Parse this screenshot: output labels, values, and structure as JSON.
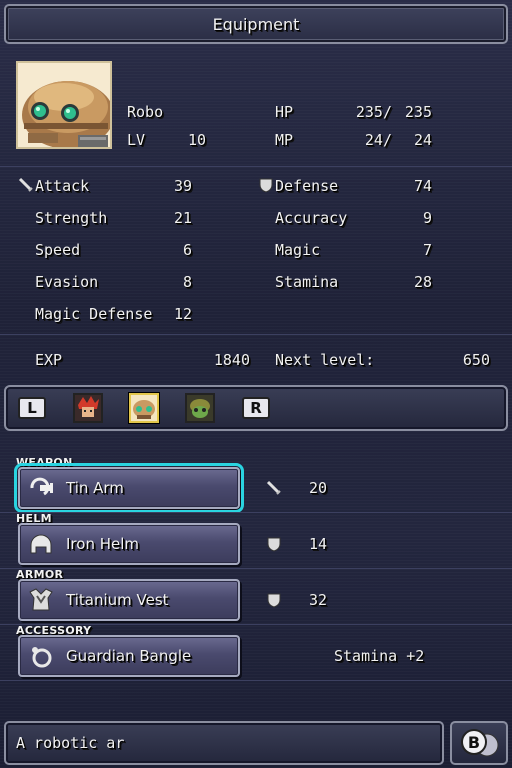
{
  "title": "Equipment",
  "character": {
    "name": "Robo",
    "lv_label": "LV",
    "lv": "10",
    "hp_label": "HP",
    "hp_current": "235/",
    "hp_max": "235",
    "mp_label": "MP",
    "mp_current": "24/",
    "mp_max": "24"
  },
  "stats": {
    "attack_label": "Attack",
    "attack": "39",
    "defense_label": "Defense",
    "defense": "74",
    "strength_label": "Strength",
    "strength": "21",
    "accuracy_label": "Accuracy",
    "accuracy": "9",
    "speed_label": "Speed",
    "speed": "6",
    "magic_label": "Magic",
    "magic": "7",
    "evasion_label": "Evasion",
    "evasion": "8",
    "stamina_label": "Stamina",
    "stamina": "28",
    "magic_defense_label": "Magic Defense",
    "magic_defense": "12",
    "exp_label": "EXP",
    "exp": "1840",
    "next_level_label": "Next level:",
    "next_level": "650"
  },
  "party_strip": {
    "left_button": "L",
    "right_button": "R"
  },
  "slots": [
    {
      "label": "WEAPON",
      "item": "Tin Arm",
      "value": "20",
      "icon": "arm-cannon-icon",
      "value_icon": "sword-icon"
    },
    {
      "label": "HELM",
      "item": "Iron Helm",
      "value": "14",
      "icon": "helm-icon",
      "value_icon": "shield-icon"
    },
    {
      "label": "ARMOR",
      "item": "Titanium Vest",
      "value": "32",
      "icon": "vest-icon",
      "value_icon": "shield-icon"
    },
    {
      "label": "ACCESSORY",
      "item": "Guardian Bangle",
      "value": "Stamina +2",
      "icon": "bangle-icon"
    }
  ],
  "message": "A robotic ar",
  "back_button": "B",
  "colors": {
    "selection": "#2ad4e0",
    "panel": "#2a2d44",
    "button": "#4a4a6e"
  }
}
